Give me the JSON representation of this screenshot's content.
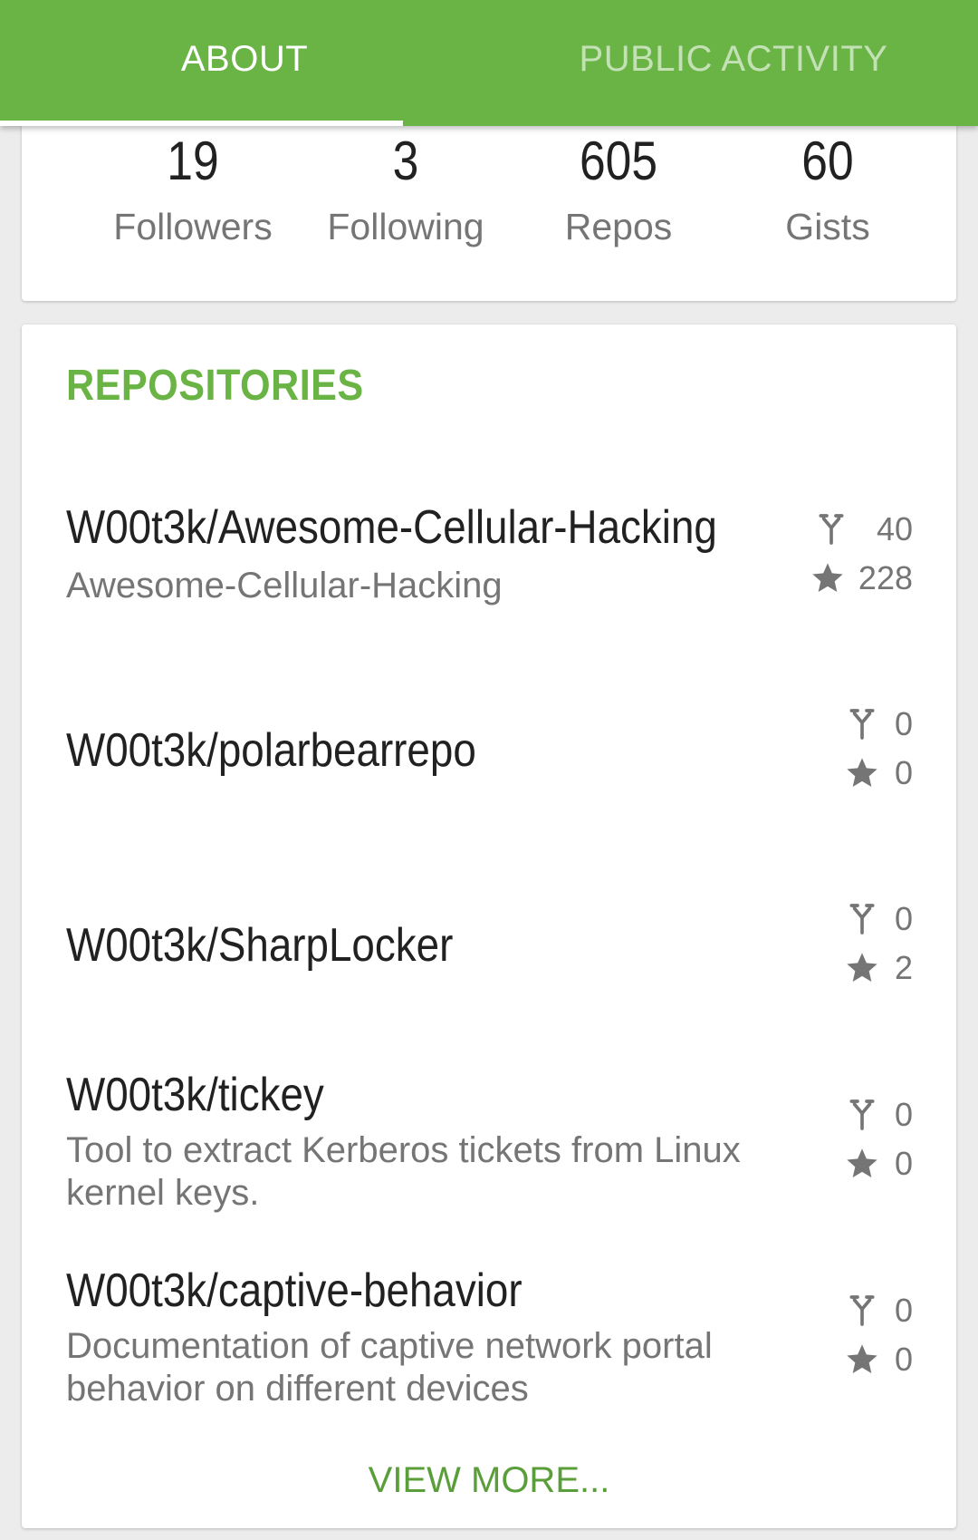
{
  "tabs": [
    {
      "label": "ABOUT",
      "active": true
    },
    {
      "label": "PUBLIC ACTIVITY",
      "active": false
    }
  ],
  "stats": [
    {
      "value": "19",
      "label": "Followers"
    },
    {
      "value": "3",
      "label": "Following"
    },
    {
      "value": "605",
      "label": "Repos"
    },
    {
      "value": "60",
      "label": "Gists"
    }
  ],
  "repositories": {
    "title": "REPOSITORIES",
    "items": [
      {
        "name": "W00t3k/Awesome-Cellular-Hacking",
        "description": "Awesome-Cellular-Hacking",
        "forks": "40",
        "stars": "228"
      },
      {
        "name": "W00t3k/polarbearrepo",
        "description": "",
        "forks": "0",
        "stars": "0"
      },
      {
        "name": "W00t3k/SharpLocker",
        "description": "",
        "forks": "0",
        "stars": "2"
      },
      {
        "name": "W00t3k/tickey",
        "description": "Tool to extract Kerberos tickets from Linux kernel keys.",
        "forks": "0",
        "stars": "0"
      },
      {
        "name": "W00t3k/captive-behavior",
        "description": "Documentation of captive network portal behavior on different devices",
        "forks": "0",
        "stars": "0"
      }
    ],
    "view_more": "VIEW MORE..."
  },
  "icons": {
    "fork": "fork-icon",
    "star": "star-icon"
  },
  "colors": {
    "accent": "#6ab446",
    "link": "#5a9e3a",
    "text_primary": "#212121",
    "text_secondary": "#757575"
  }
}
